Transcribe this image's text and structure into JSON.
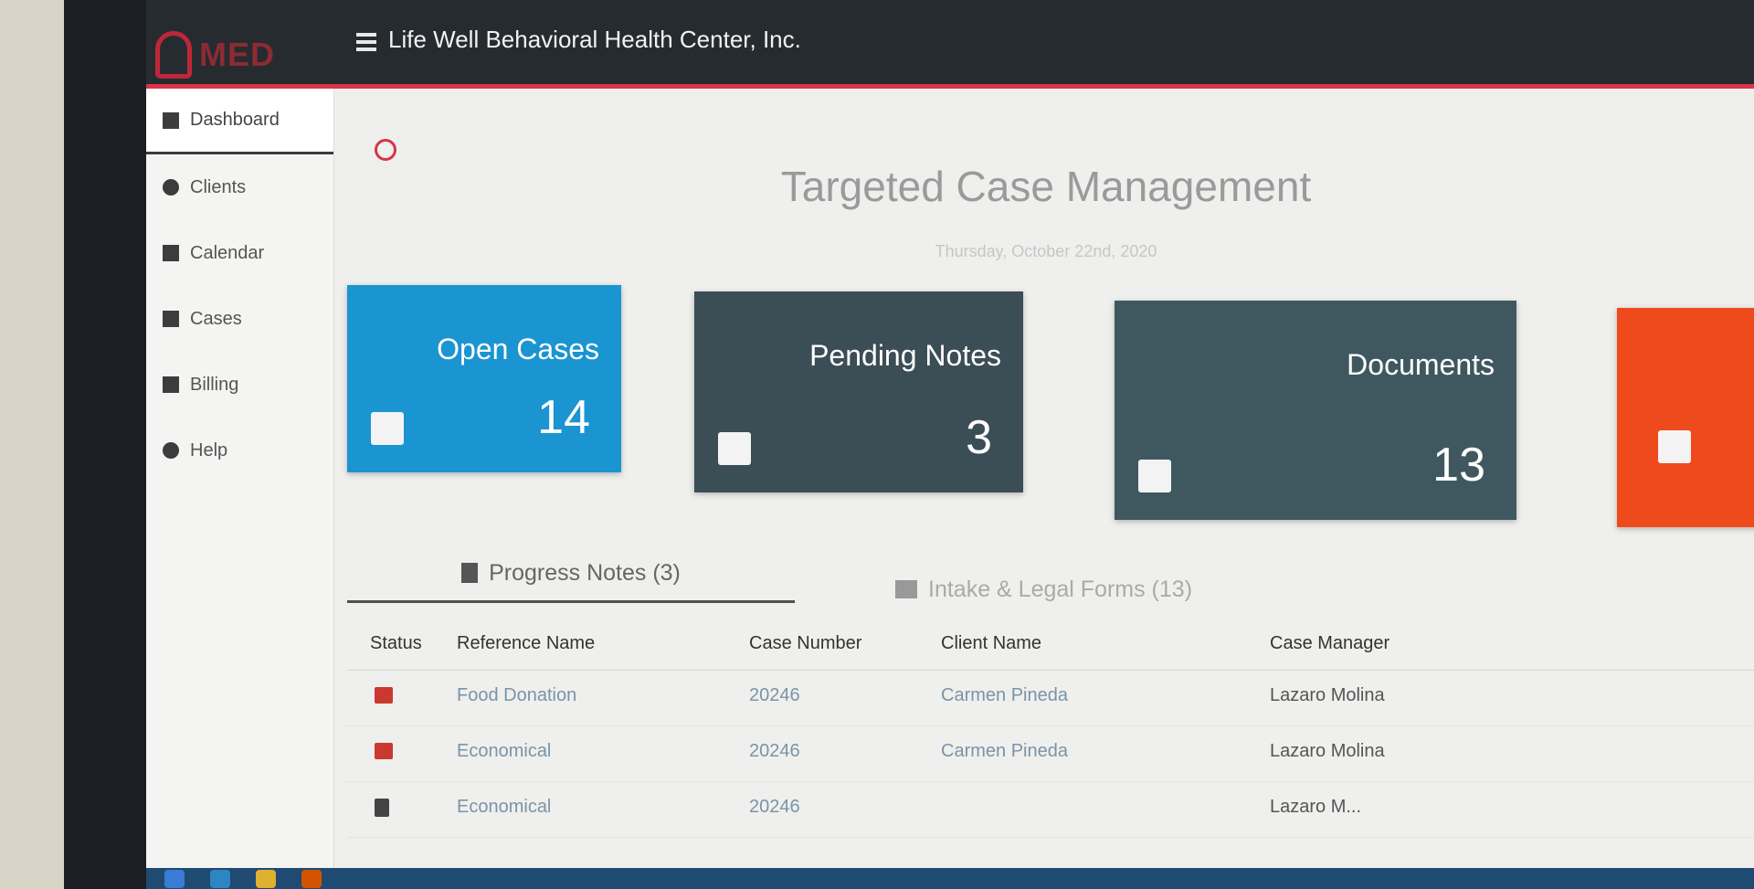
{
  "header": {
    "logo_text": "MED",
    "org_name": "Life Well Behavioral Health Center, Inc."
  },
  "sidebar": {
    "items": [
      {
        "label": "Dashboard",
        "icon": "dashboard-icon",
        "active": true
      },
      {
        "label": "Clients",
        "icon": "person-icon"
      },
      {
        "label": "Calendar",
        "icon": "calendar-icon"
      },
      {
        "label": "Cases",
        "icon": "briefcase-icon"
      },
      {
        "label": "Billing",
        "icon": "bank-icon"
      },
      {
        "label": "Help",
        "icon": "help-icon"
      }
    ]
  },
  "main": {
    "title": "Targeted Case Management",
    "date": "Thursday, October 22nd, 2020",
    "cards": [
      {
        "title": "Open Cases",
        "count": "14",
        "icon": "briefcase-icon",
        "color": "#1a95d1"
      },
      {
        "title": "Pending Notes",
        "count": "3",
        "icon": "document-icon",
        "color": "#3b4d55"
      },
      {
        "title": "Documents",
        "count": "13",
        "icon": "folder-user-icon",
        "color": "#3f5860"
      },
      {
        "title": "",
        "count": "",
        "icon": "document-icon",
        "color": "#ef4a1c"
      }
    ],
    "tabs": [
      {
        "label": "Progress Notes (3)",
        "icon": "document-icon",
        "active": true
      },
      {
        "label": "Intake & Legal Forms (13)",
        "icon": "contact-card-icon"
      }
    ],
    "table": {
      "headers": {
        "status": "Status",
        "reference": "Reference Name",
        "case_number": "Case Number",
        "client": "Client Name",
        "manager": "Case Manager"
      },
      "rows": [
        {
          "status_icon": "thumbs-down-icon",
          "reference": "Food Donation",
          "case_number": "20246",
          "client": "Carmen Pineda",
          "manager": "Lazaro Molina"
        },
        {
          "status_icon": "thumbs-down-icon",
          "reference": "Economical",
          "case_number": "20246",
          "client": "Carmen Pineda",
          "manager": "Lazaro Molina"
        },
        {
          "status_icon": "clipboard-clock-icon",
          "reference": "Economical",
          "case_number": "20246",
          "client": "",
          "manager": "Lazaro M..."
        }
      ]
    }
  },
  "colors": {
    "accent": "#d8344a",
    "topbar": "#262b30",
    "open_cases": "#1a95d1",
    "pending_notes": "#3b4d55",
    "documents": "#3f5860",
    "orange": "#ef4a1c"
  }
}
